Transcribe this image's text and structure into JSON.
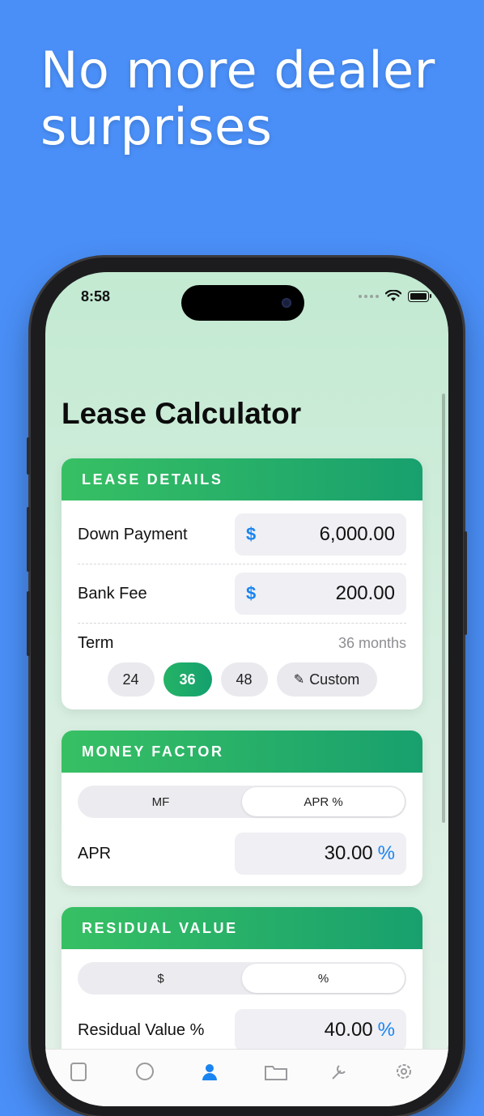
{
  "headline": {
    "line1": "No more dealer",
    "line2": "surprises"
  },
  "status_bar": {
    "time": "8:58"
  },
  "title": "Lease Calculator",
  "lease_details": {
    "header": "LEASE DETAILS",
    "down_payment": {
      "label": "Down Payment",
      "prefix": "$",
      "value": "6,000.00"
    },
    "bank_fee": {
      "label": "Bank Fee",
      "prefix": "$",
      "value": "200.00"
    },
    "term": {
      "label": "Term",
      "value": "36 months",
      "options": [
        "24",
        "36",
        "48"
      ],
      "selected": "36",
      "custom_label": "Custom"
    }
  },
  "money_factor": {
    "header": "MONEY FACTOR",
    "segments": [
      "MF",
      "APR %"
    ],
    "selected_segment": "APR %",
    "apr": {
      "label": "APR",
      "value": "30.00",
      "suffix": "%"
    }
  },
  "residual_value": {
    "header": "RESIDUAL VALUE",
    "segments": [
      "$",
      "%"
    ],
    "selected_segment": "%",
    "field": {
      "label": "Residual Value %",
      "value": "40.00",
      "suffix": "%"
    }
  },
  "tabbar": {
    "icons": [
      "calculator-icon",
      "compass-icon",
      "person-icon",
      "folder-icon",
      "tools-icon",
      "gear-icon"
    ],
    "active_index": 2,
    "active_color": "#1a84f0"
  },
  "colors": {
    "background": "#4a8ff7",
    "header_gradient_start": "#37c063",
    "header_gradient_end": "#18a06e",
    "accent_blue": "#1a84f0"
  }
}
